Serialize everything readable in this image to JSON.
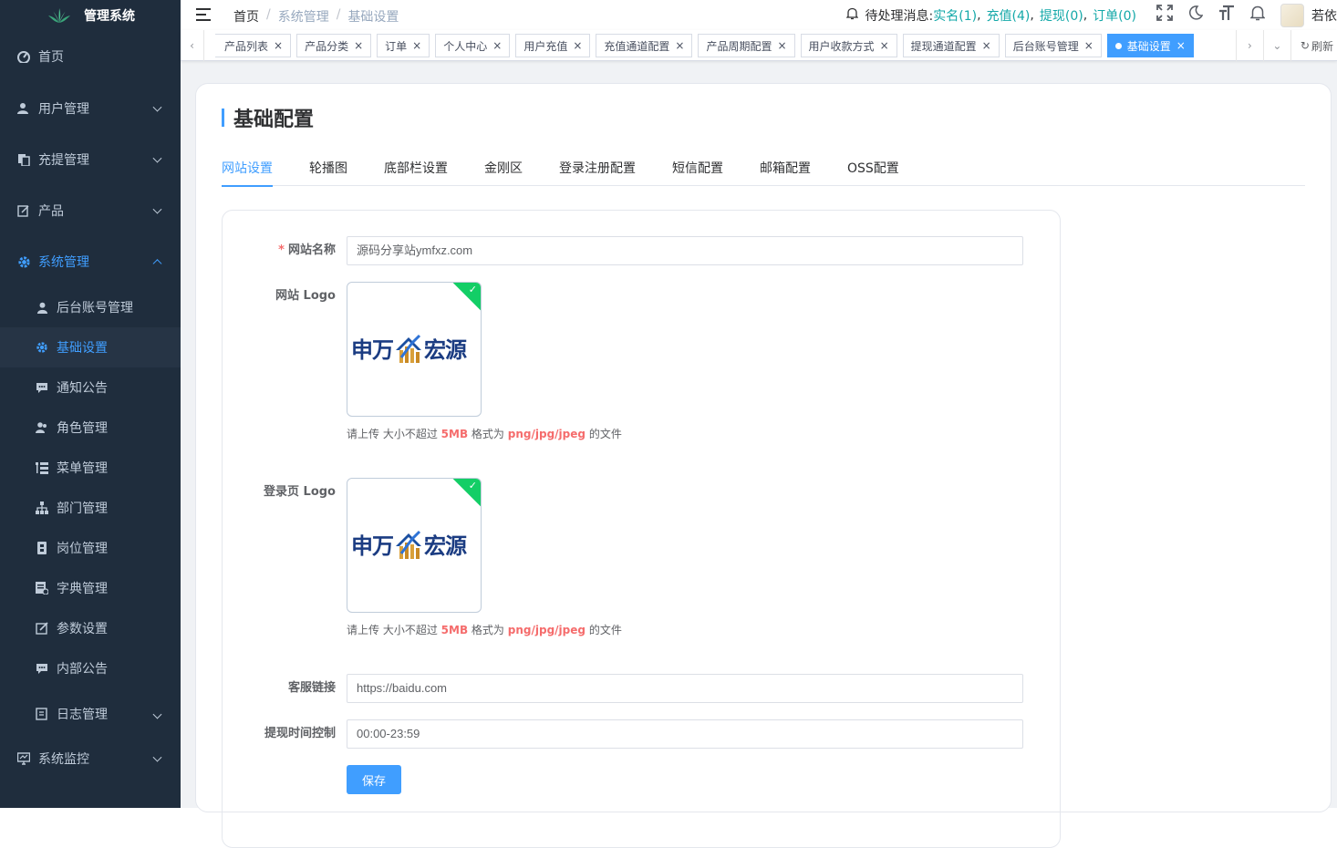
{
  "app": {
    "title": "管理系统"
  },
  "sidebar": {
    "items": [
      {
        "label": "首页",
        "icon": "dashboard-icon"
      },
      {
        "label": "用户管理",
        "icon": "user-icon"
      },
      {
        "label": "充提管理",
        "icon": "documents-icon"
      },
      {
        "label": "产品",
        "icon": "edit-icon"
      },
      {
        "label": "系统管理",
        "icon": "gear-icon"
      }
    ],
    "sub_items": [
      {
        "label": "后台账号管理",
        "icon": "person-icon"
      },
      {
        "label": "基础设置",
        "icon": "gear-icon"
      },
      {
        "label": "通知公告",
        "icon": "message-icon"
      },
      {
        "label": "角色管理",
        "icon": "peoples-icon"
      },
      {
        "label": "菜单管理",
        "icon": "tree-table-icon"
      },
      {
        "label": "部门管理",
        "icon": "tree-icon"
      },
      {
        "label": "岗位管理",
        "icon": "post-icon"
      },
      {
        "label": "字典管理",
        "icon": "dict-icon"
      },
      {
        "label": "参数设置",
        "icon": "edit-icon"
      },
      {
        "label": "内部公告",
        "icon": "message-icon"
      },
      {
        "label": "日志管理",
        "icon": "log-icon"
      }
    ],
    "bottom": {
      "label": "系统监控",
      "icon": "monitor-icon"
    }
  },
  "breadcrumb": [
    "首页",
    "系统管理",
    "基础设置"
  ],
  "navbar": {
    "pending_label": "待处理消息:",
    "pending_links": [
      "实名(1)",
      "充值(4)",
      "提现(0)",
      "订单(0)"
    ],
    "username": "若依"
  },
  "tags": [
    "产品列表",
    "产品分类",
    "订单",
    "个人中心",
    "用户充值",
    "充值通道配置",
    "产品周期配置",
    "用户收款方式",
    "提现通道配置",
    "后台账号管理",
    "基础设置"
  ],
  "tags_refresh": "刷新",
  "page": {
    "title": "基础配置",
    "tabs": [
      "网站设置",
      "轮播图",
      "底部栏设置",
      "金刚区",
      "登录注册配置",
      "短信配置",
      "邮箱配置",
      "OSS配置"
    ]
  },
  "form": {
    "site_name_label": "网站名称",
    "site_name_value": "源码分享站ymfxz.com",
    "site_logo_label": "网站 Logo",
    "login_logo_label": "登录页 Logo",
    "logo_text_left": "申万",
    "logo_text_right": "宏源",
    "tip_prefix": "请上传 大小不超过",
    "tip_size": "5MB",
    "tip_mid": "格式为",
    "tip_format": "png/jpg/jpeg",
    "tip_suffix": "的文件",
    "service_link_label": "客服链接",
    "service_link_value": "https://baidu.com",
    "withdraw_time_label": "提现时间控制",
    "withdraw_time_value": "00:00-23:59",
    "save_label": "保存"
  },
  "colors": {
    "sidebar_bg": "#1f2d3d",
    "accent": "#409eff",
    "pending_link": "#13a8a8",
    "danger": "#f56c6c",
    "success": "#13ce66"
  }
}
